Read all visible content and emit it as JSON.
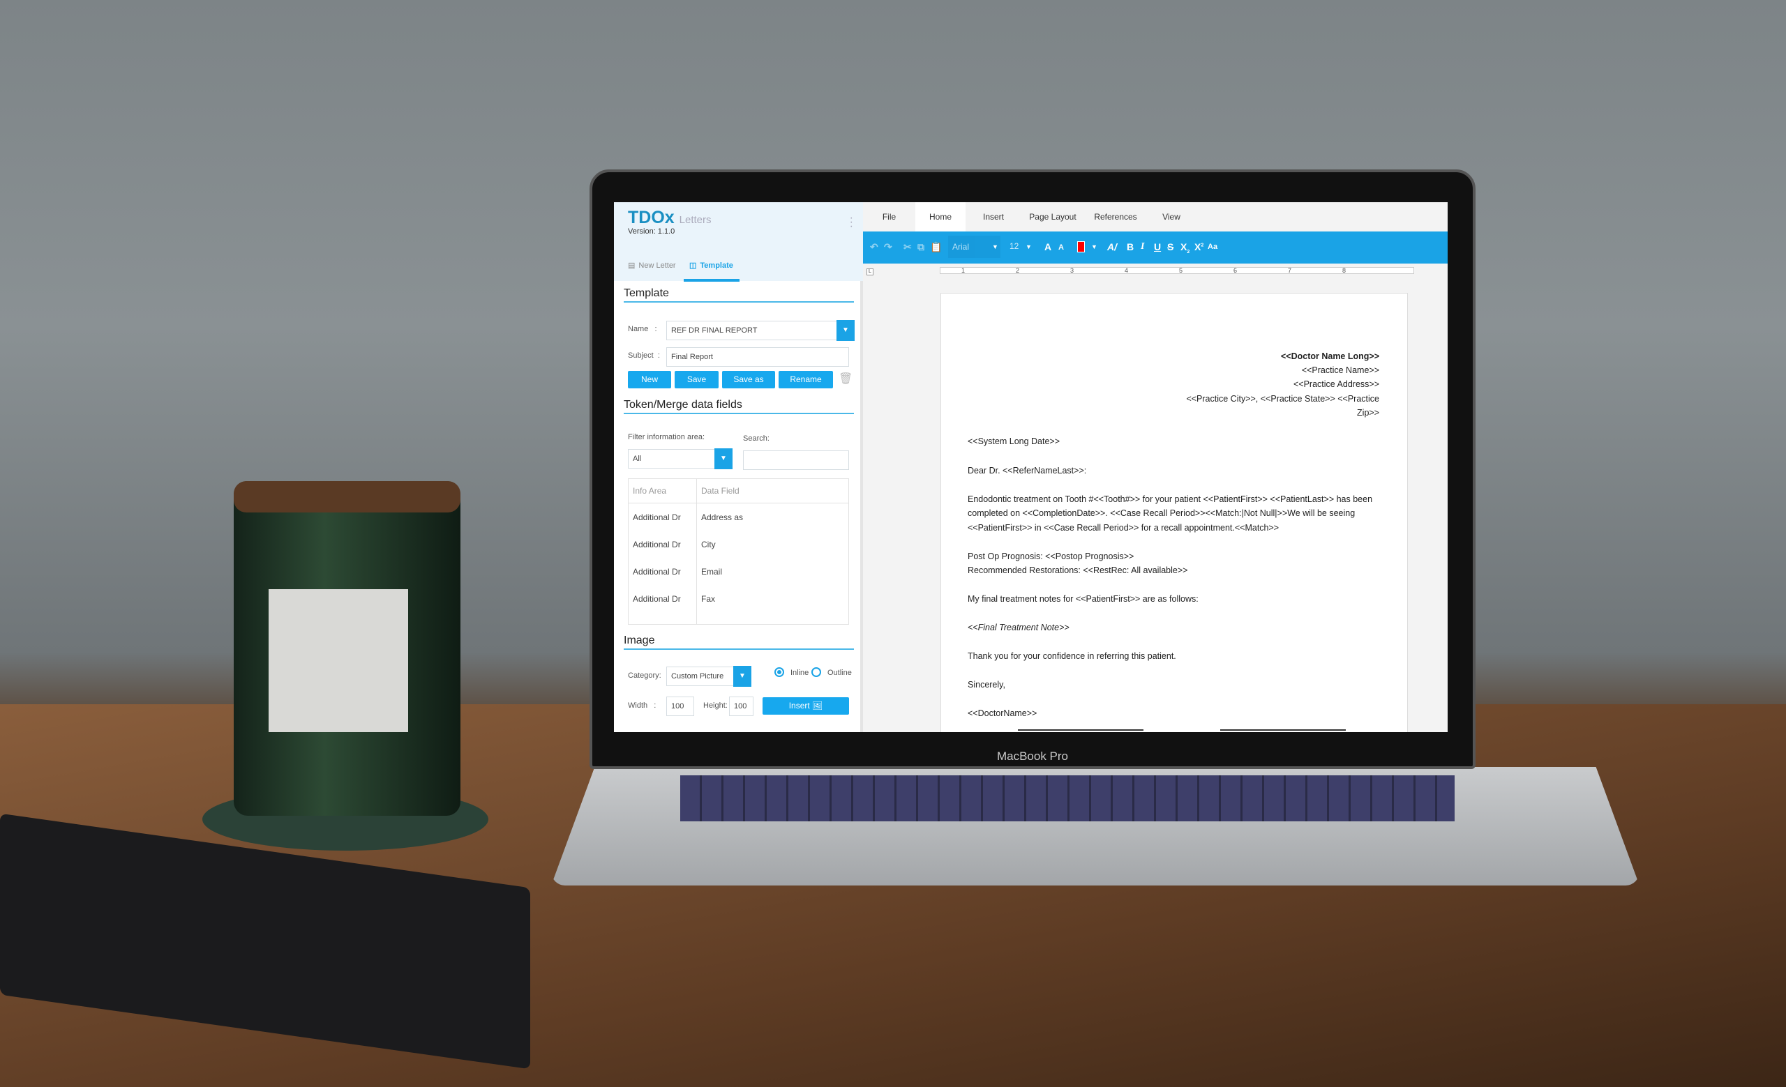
{
  "scene": {
    "laptop_brand": "MacBook Pro"
  },
  "app": {
    "logo": "TDOx",
    "logo_suffix": "Letters",
    "version": "Version: 1.1.0",
    "tabs": [
      {
        "label": "New Letter",
        "icon": "document-icon",
        "active": false
      },
      {
        "label": "Template",
        "icon": "template-icon",
        "active": true
      }
    ]
  },
  "template": {
    "heading": "Template",
    "name_label": "Name",
    "name_value": "REF DR FINAL REPORT",
    "subject_label": "Subject",
    "subject_value": "Final Report",
    "buttons": {
      "new": "New",
      "save": "Save",
      "save_as": "Save as",
      "rename": "Rename"
    }
  },
  "tokens": {
    "heading": "Token/Merge data fields",
    "filter_label": "Filter information area:",
    "filter_value": "All",
    "search_label": "Search:",
    "search_value": "",
    "columns": [
      "Info Area",
      "Data Field"
    ],
    "rows": [
      [
        "Additional Dr",
        "Address as"
      ],
      [
        "Additional Dr",
        "City"
      ],
      [
        "Additional Dr",
        "Email"
      ],
      [
        "Additional Dr",
        "Fax"
      ]
    ]
  },
  "image": {
    "heading": "Image",
    "category_label": "Category:",
    "category_value": "Custom Picture",
    "inline_label": "Inline",
    "outline_label": "Outline",
    "selected": "Inline",
    "width_label": "Width",
    "width_value": "100",
    "height_label": "Height:",
    "height_value": "100",
    "insert_label": "Insert"
  },
  "editor": {
    "menu": [
      "File",
      "Home",
      "Insert",
      "Page Layout",
      "References",
      "View"
    ],
    "active_menu": "Home",
    "font": "Arial",
    "size": "12",
    "font_color": "#ff0000",
    "accent": "#1aa3e6",
    "ruler_marks": [
      "1",
      "2",
      "3",
      "4",
      "5",
      "6",
      "7",
      "8"
    ],
    "letter": {
      "header": [
        "<<Doctor Name Long>>",
        "<<Practice Name>>",
        "<<Practice Address>>",
        "<<Practice City>>, <<Practice State>>  <<Practice",
        "Zip>>"
      ],
      "date": "<<System Long Date>>",
      "salutation": "Dear Dr. <<ReferNameLast>>:",
      "para": [
        "Endodontic treatment on Tooth #<<Tooth#>> for your patient <<PatientFirst>> <<PatientLast>> has been",
        "completed on <<CompletionDate>>.  <<Case Recall Period>><<Match:|Not Null|>>We will be seeing",
        "<<PatientFirst>> in <<Case Recall Period>> for a recall appointment.<<Match>>"
      ],
      "prognosis": "Post Op Prognosis: <<Postop Prognosis>>",
      "restorations": "Recommended Restorations:  <<RestRec: All available>>",
      "notes_intro": "My final treatment notes for <<PatientFirst>> are as follows:",
      "notes": "<<Final Treatment Note>>",
      "thanks": "Thank you for your confidence in referring this patient.",
      "closing": "Sincerely,",
      "signature": "<<DoctorName>>"
    }
  }
}
